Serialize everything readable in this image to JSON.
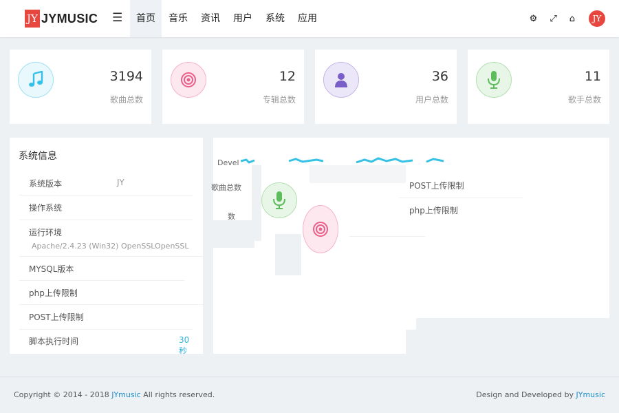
{
  "header": {
    "logo_mark": "JY",
    "logo_text": "JYMUSIC",
    "nav": [
      "首页",
      "音乐",
      "资讯",
      "用户",
      "系统",
      "应用"
    ],
    "avatar_text": "JY"
  },
  "stats": [
    {
      "value": "3194",
      "label": "歌曲总数",
      "icon": "music-note-icon",
      "color": "#35c1e6",
      "bg": "#e8f8fd"
    },
    {
      "value": "12",
      "label": "专辑总数",
      "icon": "disc-icon",
      "color": "#e8608a",
      "bg": "#fde8ef"
    },
    {
      "value": "36",
      "label": "用户总数",
      "icon": "user-icon",
      "color": "#7a5ec7",
      "bg": "#ece7f8"
    },
    {
      "value": "11",
      "label": "歌手总数",
      "icon": "microphone-icon",
      "color": "#5dbd5d",
      "bg": "#e7f6e6"
    }
  ],
  "system_info": {
    "title": "系统信息",
    "rows": [
      {
        "key": "系统版本",
        "value": "JY"
      },
      {
        "key": "操作系统",
        "value": ""
      },
      {
        "key": "运行环境",
        "value": ""
      },
      {
        "key": "",
        "value": "Apache/2.4.23 (Win32) OpenSSLOpenSSL"
      },
      {
        "key": "MYSQL版本",
        "value": ""
      },
      {
        "key": "php上传限制",
        "value": ""
      },
      {
        "key": "POST上传限制",
        "value": ""
      },
      {
        "key": "脚本执行时间",
        "value": "30秒"
      }
    ]
  },
  "glitch_panel": {
    "dev_text": "Devel",
    "song_total": "歌曲总数",
    "num_fragment": "数",
    "post_limit": "POST上传限制",
    "php_limit": "php上传限制"
  },
  "footer": {
    "copyright_prefix": "Copyright © 2014 - 2018",
    "brand": "JYmusic",
    "copyright_suffix": "All rights reserved.",
    "right_prefix": "Design and Developed by",
    "right_brand": "JYmusic"
  }
}
